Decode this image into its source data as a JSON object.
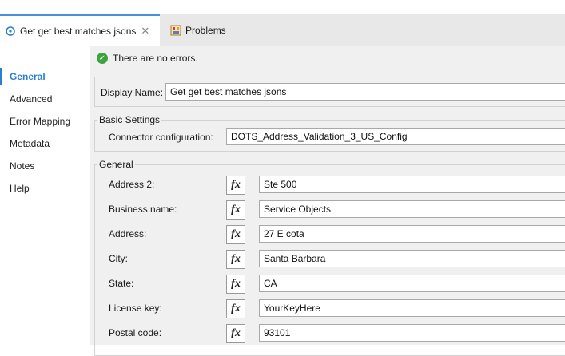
{
  "tabs": [
    {
      "label": "Get get best matches jsons",
      "icon": "connector-icon",
      "active": true
    },
    {
      "label": "Problems",
      "icon": "problems-icon",
      "active": false
    }
  ],
  "sidebar": {
    "items": [
      {
        "label": "General"
      },
      {
        "label": "Advanced"
      },
      {
        "label": "Error Mapping"
      },
      {
        "label": "Metadata"
      },
      {
        "label": "Notes"
      },
      {
        "label": "Help"
      }
    ]
  },
  "status": {
    "message": "There are no errors."
  },
  "display_name": {
    "label": "Display Name:",
    "value": "Get get best matches jsons"
  },
  "basic_settings": {
    "title": "Basic Settings",
    "connector_label": "Connector configuration:",
    "connector_value": "DOTS_Address_Validation_3_US_Config"
  },
  "general": {
    "title": "General",
    "fields": [
      {
        "label": "Address 2:",
        "value": "Ste 500"
      },
      {
        "label": "Business name:",
        "value": "Service Objects"
      },
      {
        "label": "Address:",
        "value": "27 E cota"
      },
      {
        "label": "City:",
        "value": "Santa Barbara"
      },
      {
        "label": "State:",
        "value": "CA"
      },
      {
        "label": "License key:",
        "value": "YourKeyHere"
      },
      {
        "label": "Postal code:",
        "value": "93101"
      }
    ]
  },
  "fx_label": "fx",
  "colors": {
    "accent": "#2a7fd0",
    "ok": "#3ea33e",
    "panel": "#f0f0f0"
  }
}
